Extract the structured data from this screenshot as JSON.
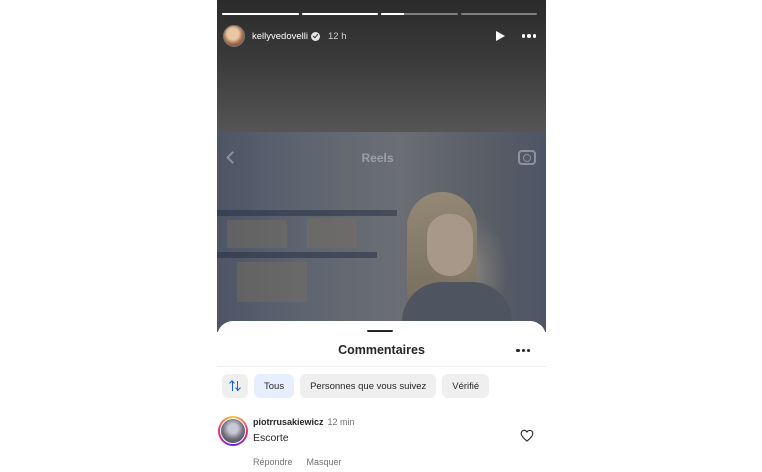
{
  "story": {
    "progress": [
      1,
      1,
      0.3,
      0
    ],
    "username": "kellyvedovelli",
    "verified": true,
    "time": "12 h",
    "play_icon": "play-icon",
    "more_icon": "more-horizontal-icon"
  },
  "reel": {
    "title": "Reels",
    "back_icon": "chevron-left-icon",
    "camera_icon": "camera-icon"
  },
  "comments_sheet": {
    "title": "Commentaires",
    "more_icon": "more-horizontal-icon",
    "sort_icon": "sort-arrows-icon",
    "filters": [
      {
        "label": "Tous",
        "active": true
      },
      {
        "label": "Personnes que vous suivez",
        "active": false
      },
      {
        "label": "Vérifié",
        "active": false
      }
    ],
    "comments": [
      {
        "user": "piotrrusakiewicz",
        "time": "12 min",
        "text": "Escorte",
        "reply_label": "Répondre",
        "hide_label": "Masquer",
        "like_icon": "heart-outline-icon"
      }
    ]
  },
  "colors": {
    "accent": "#1a5bd8",
    "active_chip_bg": "#e7efff",
    "text_primary": "#262626",
    "text_secondary": "#737373"
  }
}
